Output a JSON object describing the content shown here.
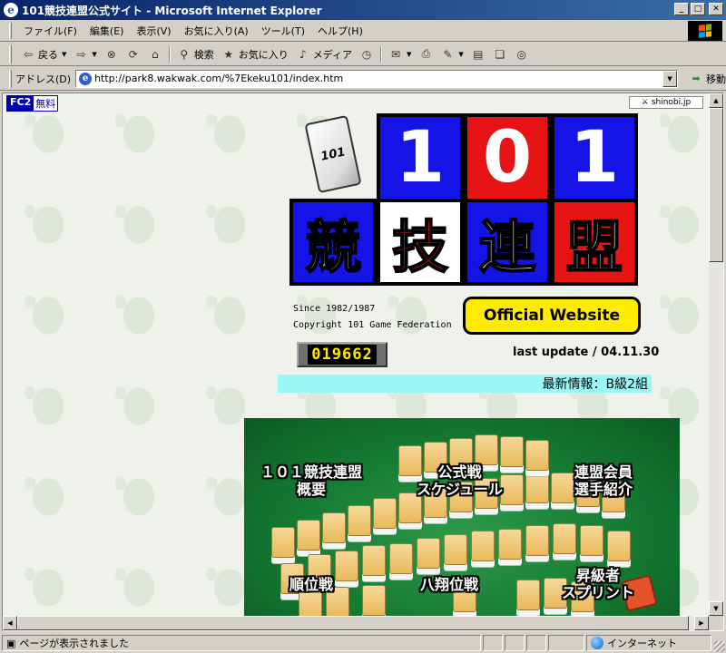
{
  "window": {
    "title": "101競技連盟公式サイト - Microsoft Internet Explorer"
  },
  "menu": [
    "ファイル(F)",
    "編集(E)",
    "表示(V)",
    "お気に入り(A)",
    "ツール(T)",
    "ヘルプ(H)"
  ],
  "toolbar": {
    "back": "戻る",
    "search": "検索",
    "favorites": "お気に入り",
    "media": "メディア"
  },
  "address": {
    "label": "アドレス(D)",
    "url": "http://park8.wakwak.com/%7Ekeku101/index.htm",
    "go": "移動"
  },
  "page": {
    "fc2": {
      "brand": "FC2",
      "free": "無料"
    },
    "shinobi": "shinobi.jp",
    "tile_text": "101",
    "logo_numbers": [
      "1",
      "0",
      "1"
    ],
    "logo_kanji": [
      "競",
      "技",
      "連",
      "盟"
    ],
    "since": "Since 1982/1987",
    "copyright": "Copyright 101 Game Federation",
    "official": "Official Website",
    "counter": "019662",
    "last_update": "last update / 04.11.30",
    "news": "最新情報：B級2組",
    "banner_links": {
      "about_1": "１０１競技連盟",
      "about_2": "概要",
      "schedule_1": "公式戦",
      "schedule_2": "スケジュール",
      "members_1": "連盟会員",
      "members_2": "選手紹介",
      "ranking": "順位戦",
      "hassho": "八翔位戦",
      "promotion_1": "昇級者",
      "promotion_2": "スプリント"
    }
  },
  "status": {
    "text": "ページが表示されました",
    "zone": "インターネット"
  }
}
